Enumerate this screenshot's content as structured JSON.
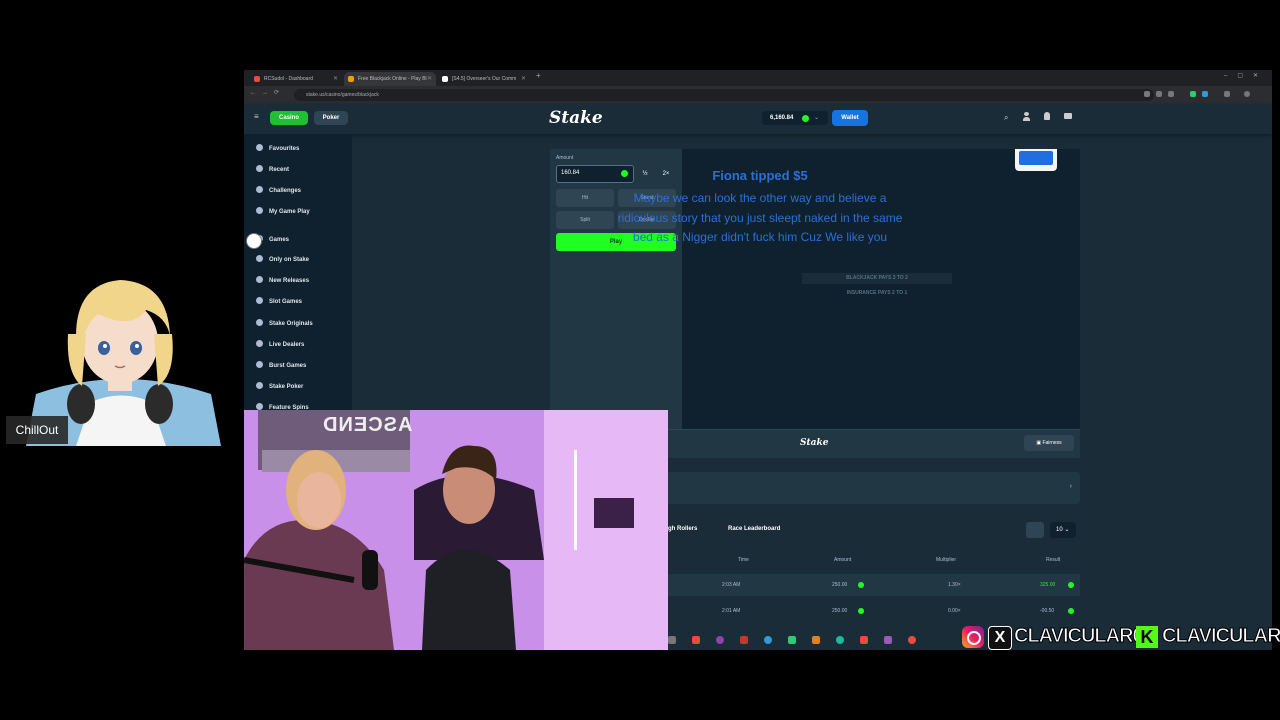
{
  "browser": {
    "tabs": [
      {
        "label": "RCSudol - Dashboard",
        "color": "#e74c3c"
      },
      {
        "label": "Free Blackjack Online - Play Bl",
        "color": "#f39c12"
      },
      {
        "label": "[S4.5] Overseer's Our Comm",
        "color": "#ffffff"
      }
    ],
    "url": "stake.us/casino/games/blackjack"
  },
  "header": {
    "casino_label": "Casino",
    "poker_label": "Poker",
    "logo": "Stake",
    "balance": "6,160.84",
    "wallet_label": "Wallet"
  },
  "sidebar": {
    "items": [
      {
        "label": "Favourites",
        "icon": "star-icon"
      },
      {
        "label": "Recent",
        "icon": "clock-icon"
      },
      {
        "label": "Challenges",
        "icon": "trophy-icon"
      },
      {
        "label": "My Game Play",
        "icon": "controller-icon"
      },
      {
        "label": "Games",
        "icon": "games-icon"
      },
      {
        "label": "Only on Stake",
        "icon": "gem-icon"
      },
      {
        "label": "New Releases",
        "icon": "rocket-icon"
      },
      {
        "label": "Slot Games",
        "icon": "slot-icon"
      },
      {
        "label": "Stake Originals",
        "icon": "stake-icon"
      },
      {
        "label": "Live Dealers",
        "icon": "headset-icon"
      },
      {
        "label": "Burst Games",
        "icon": "burst-icon"
      },
      {
        "label": "Stake Poker",
        "icon": "cards-icon"
      },
      {
        "label": "Feature Spins",
        "icon": "spin-icon"
      }
    ]
  },
  "controls": {
    "amount_label": "Amount",
    "amount_value": "160.84",
    "half_label": "½",
    "double_label": "2×",
    "hit_label": "Hit",
    "stand_label": "Stand",
    "split_label": "Split",
    "double_action_label": "Double",
    "play_label": "Play"
  },
  "table": {
    "line1": "BLACKJACK PAYS 3 TO 2",
    "line2": "INSURANCE PAYS 2 TO 1"
  },
  "footer": {
    "logo": "Stake",
    "fairness_label": "Fairness"
  },
  "bets": {
    "tabs": [
      "High Rollers",
      "Race Leaderboard"
    ],
    "count_value": "10",
    "headers": [
      "Time",
      "Amount",
      "Multiplier",
      "Result"
    ],
    "rows": [
      {
        "time": "2:03 AM",
        "amount": "250.00",
        "multiplier": "1.30×",
        "result": "325.00",
        "result_color": "#1fff20"
      },
      {
        "time": "2:01 AM",
        "amount": "250.00",
        "multiplier": "0.00×",
        "result": "-00.50",
        "result_color": "#b1bad3"
      }
    ]
  },
  "alert": {
    "title": "Fiona tipped $5",
    "message": "Maybe we can look the other way and believe a ridiculous story that you just sleept naked in the same bed as a Nigger didn't fuck him Cuz We like you"
  },
  "avatar": {
    "name_tag": "ChillOut"
  },
  "webcam": {
    "poster_text": "ASCEND"
  },
  "socials": {
    "handle1": "CLAVICULAR0",
    "handle2": "CLAVICULAR"
  },
  "colors": {
    "stake_green": "#1fff20",
    "stake_blue": "#1475e1",
    "alert_blue": "#2b6fd6"
  }
}
